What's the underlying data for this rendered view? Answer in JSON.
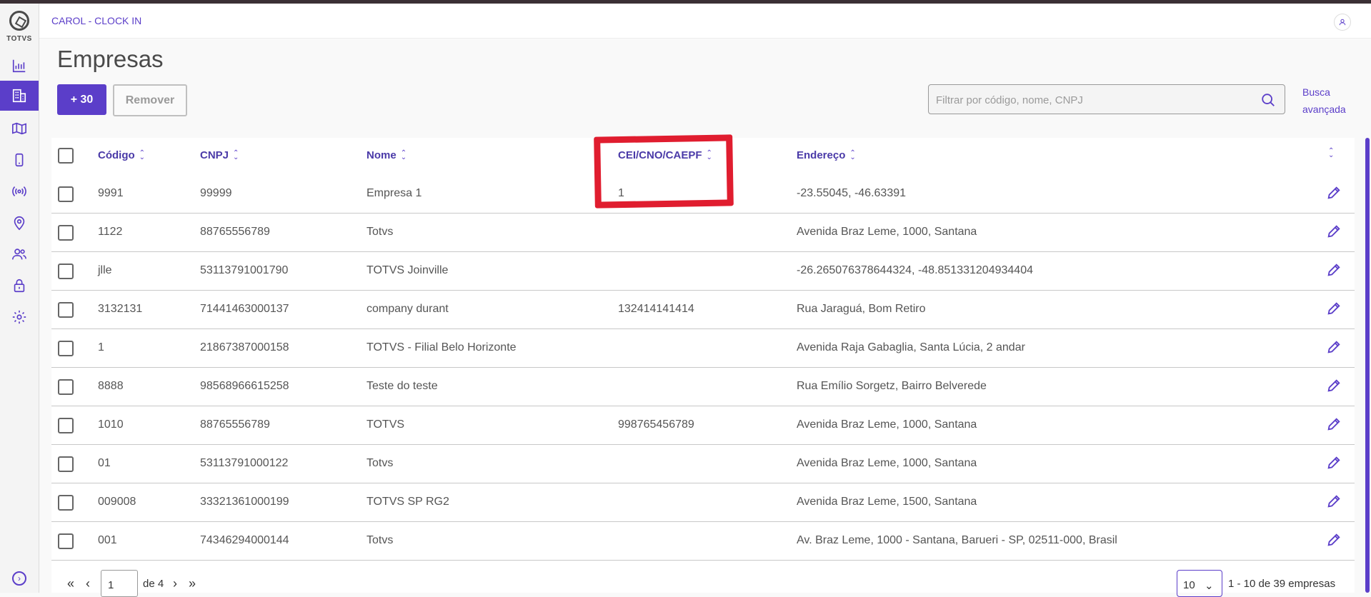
{
  "app": {
    "title": "CAROL - CLOCK IN",
    "logo_text": "TOTVS"
  },
  "sidebar": {
    "items": [
      {
        "icon": "bar-chart-icon",
        "label": "Dashboard"
      },
      {
        "icon": "building-icon",
        "label": "Empresas",
        "active": true
      },
      {
        "icon": "map-icon",
        "label": "Mapa"
      },
      {
        "icon": "mobile-icon",
        "label": "Dispositivos"
      },
      {
        "icon": "broadcast-icon",
        "label": "Sinais"
      },
      {
        "icon": "location-pin-icon",
        "label": "Locais"
      },
      {
        "icon": "users-icon",
        "label": "Usuários"
      },
      {
        "icon": "lock-icon",
        "label": "Segurança"
      },
      {
        "icon": "gear-icon",
        "label": "Configurações"
      }
    ]
  },
  "page": {
    "title": "Empresas"
  },
  "toolbar": {
    "add_label": "+ 30",
    "remove_label": "Remover"
  },
  "search": {
    "placeholder": "Filtrar por código, nome, CNPJ",
    "advanced_line1": "Busca",
    "advanced_line2": "avançada"
  },
  "table": {
    "columns": [
      "Código",
      "CNPJ",
      "Nome",
      "CEI/CNO/CAEPF",
      "Endereço"
    ],
    "rows": [
      {
        "codigo": "9991",
        "cnpj": "99999",
        "nome": "Empresa 1",
        "cei": "1",
        "endereco": "-23.55045, -46.63391"
      },
      {
        "codigo": "1122",
        "cnpj": "88765556789",
        "nome": "Totvs",
        "cei": "",
        "endereco": "Avenida Braz Leme, 1000, Santana"
      },
      {
        "codigo": "jlle",
        "cnpj": "53113791001790",
        "nome": "TOTVS Joinville",
        "cei": "",
        "endereco": "-26.265076378644324, -48.851331204934404"
      },
      {
        "codigo": "3132131",
        "cnpj": "71441463000137",
        "nome": "company durant",
        "cei": "132414141414",
        "endereco": "Rua Jaraguá, Bom Retiro"
      },
      {
        "codigo": "1",
        "cnpj": "21867387000158",
        "nome": "TOTVS - Filial Belo Horizonte",
        "cei": "",
        "endereco": "Avenida Raja Gabaglia, Santa Lúcia, 2 andar"
      },
      {
        "codigo": "8888",
        "cnpj": "98568966615258",
        "nome": "Teste do teste",
        "cei": "",
        "endereco": "Rua Emílio Sorgetz, Bairro Belverede"
      },
      {
        "codigo": "1010",
        "cnpj": "88765556789",
        "nome": "TOTVS",
        "cei": "998765456789",
        "endereco": "Avenida Braz Leme, 1000, Santana"
      },
      {
        "codigo": "01",
        "cnpj": "53113791000122",
        "nome": "Totvs",
        "cei": "",
        "endereco": "Avenida Braz Leme, 1000, Santana"
      },
      {
        "codigo": "009008",
        "cnpj": "33321361000199",
        "nome": "TOTVS SP RG2",
        "cei": "",
        "endereco": "Avenida Braz Leme, 1500, Santana"
      },
      {
        "codigo": "001",
        "cnpj": "74346294000144",
        "nome": "Totvs",
        "cei": "",
        "endereco": "Av. Braz Leme, 1000 - Santana, Barueri - SP, 02511-000, Brasil"
      }
    ]
  },
  "pagination": {
    "current_page": "1",
    "of_text": "de 4",
    "page_size": "10",
    "range_text": "1 - 10 de 39 empresas"
  },
  "colors": {
    "accent": "#5b3ec9",
    "highlight": "#e01d2f"
  }
}
